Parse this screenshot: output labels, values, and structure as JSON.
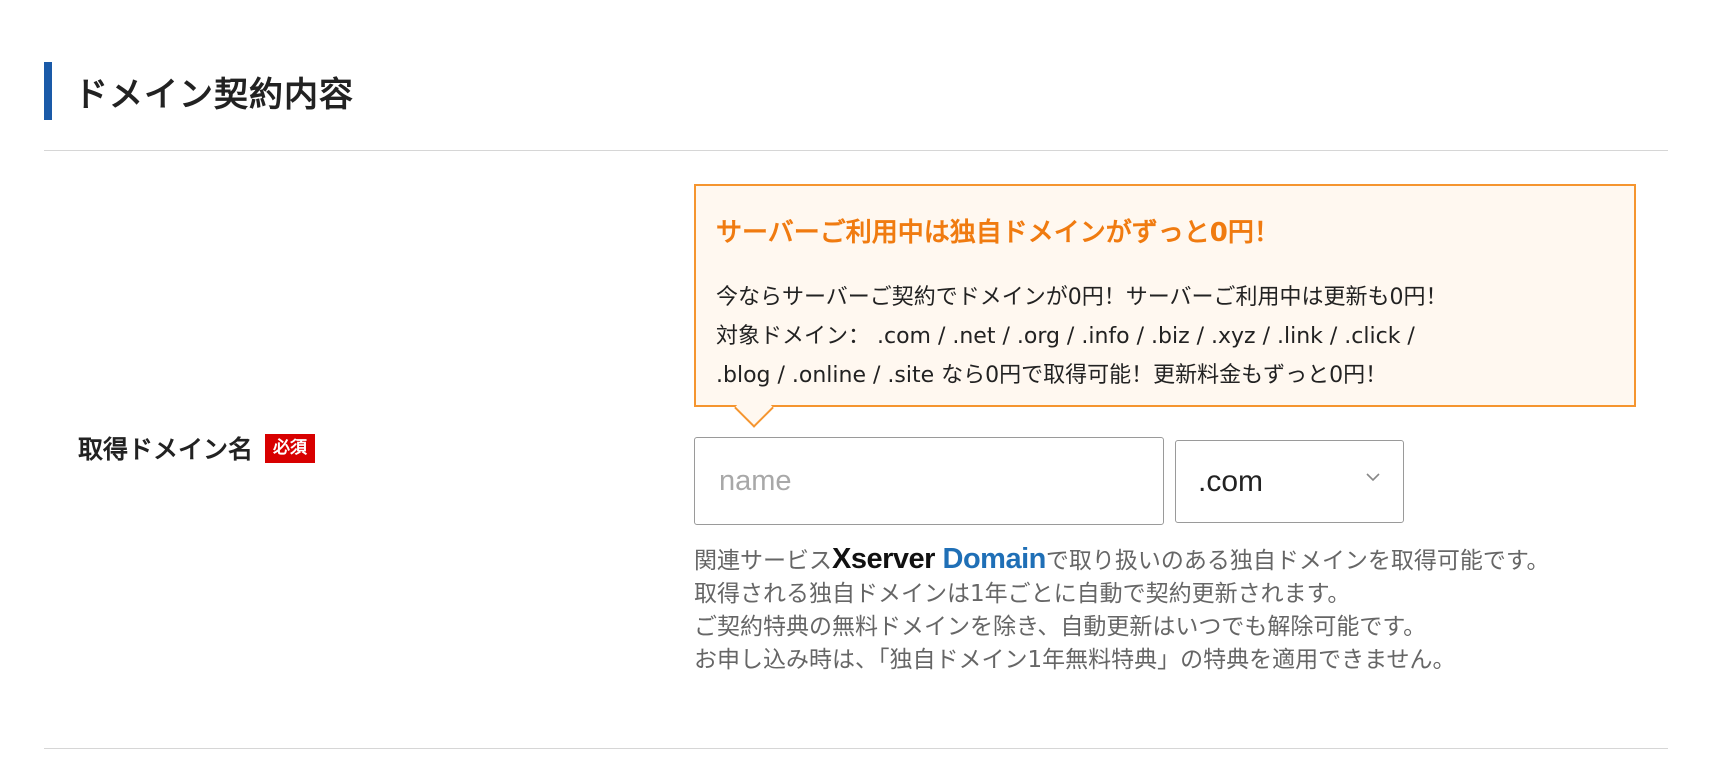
{
  "section": {
    "title": "ドメイン契約内容"
  },
  "field": {
    "label": "取得ドメイン名",
    "required_badge": "必須"
  },
  "promo": {
    "title": "サーバーご利用中は独自ドメインがずっと0円！",
    "line1": "今ならサーバーご契約でドメインが0円！サーバーご利用中は更新も0円！",
    "line2": "対象ドメイン： .com / .net / .org / .info / .biz / .xyz / .link / .click /",
    "line3": ".blog / .online / .site なら0円で取得可能！更新料金もずっと0円！"
  },
  "domain_input": {
    "value": "",
    "placeholder": "name"
  },
  "tld_select": {
    "selected": ".com",
    "icon": "chevron-down-icon"
  },
  "notes": {
    "related_prefix": "関連サービス",
    "logo_part1": "Xserver",
    "logo_part2": " Domain",
    "related_suffix": "で取り扱いのある独自ドメインを取得可能です。",
    "line2": "取得される独自ドメインは1年ごとに自動で契約更新されます。",
    "line3": "ご契約特典の無料ドメインを除き、自動更新はいつでも解除可能です。",
    "line4": "お申し込み時は、「独自ドメイン1年無料特典」の特典を適用できません。"
  },
  "colors": {
    "accent_bar": "#1a5aa8",
    "required_badge": "#d80000",
    "promo_border": "#f5952f",
    "promo_title": "#f07b10",
    "promo_bg": "#fff8f0",
    "logo_blue": "#1f6fb6"
  }
}
